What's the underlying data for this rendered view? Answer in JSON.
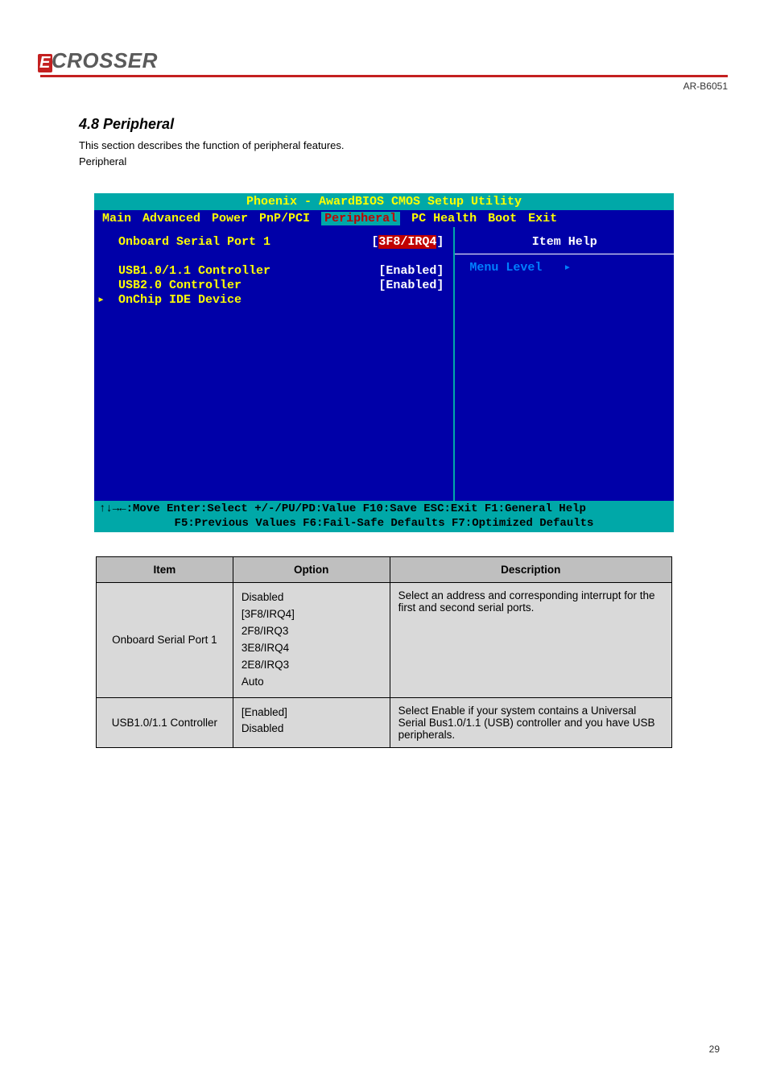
{
  "header": {
    "logo_text": "CROSSER",
    "model": "AR-B6051"
  },
  "section": {
    "title": "4.8 Peripheral",
    "desc_1": "This section describes the function of peripheral features.",
    "desc_2": "Peripheral"
  },
  "bios": {
    "title": "Phoenix - AwardBIOS CMOS Setup Utility",
    "menu": [
      "Main",
      "Advanced",
      "Power",
      "PnP/PCI",
      "Peripheral",
      "PC Health",
      "Boot",
      "Exit"
    ],
    "active_menu_index": 4,
    "rows": [
      {
        "label": "Onboard Serial Port 1",
        "value": "[3F8/IRQ4]",
        "selected": true
      },
      {
        "label": "",
        "value": ""
      },
      {
        "label": "USB1.0/1.1 Controller",
        "value": "[Enabled]"
      },
      {
        "label": "USB2.0 Controller",
        "value": "[Enabled]"
      },
      {
        "label": "OnChip IDE Device",
        "value": "",
        "submenu": true
      }
    ],
    "help_title": "Item Help",
    "help_menu_level": "Menu Level",
    "help_arrow": "▸",
    "footer_line1": "↑↓→←:Move  Enter:Select  +/-/PU/PD:Value  F10:Save  ESC:Exit  F1:General Help",
    "footer_line2": "F5:Previous Values    F6:Fail-Safe Defaults    F7:Optimized Defaults"
  },
  "table": {
    "headers": [
      "Item",
      "Option",
      "Description"
    ],
    "rows": [
      {
        "item": "Onboard Serial Port 1",
        "options": [
          "Disabled",
          "[3F8/IRQ4]",
          "2F8/IRQ3",
          "3E8/IRQ4",
          "2E8/IRQ3",
          "Auto"
        ],
        "description": "Select an address and corresponding interrupt for the first and second serial ports."
      },
      {
        "item": "USB1.0/1.1 Controller",
        "options": [
          "[Enabled]",
          "Disabled"
        ],
        "description": "Select Enable if your system contains a Universal Serial Bus1.0/1.1 (USB) controller and you have USB peripherals."
      }
    ]
  },
  "page_number": "29"
}
